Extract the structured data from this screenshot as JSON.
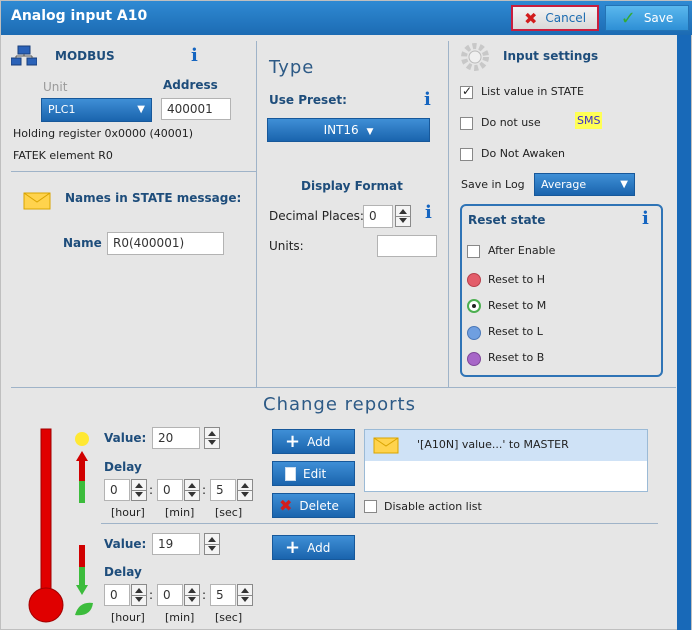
{
  "window": {
    "title": "Analog input A10",
    "cancel_label": "Cancel",
    "save_label": "Save"
  },
  "modbus": {
    "title": "MODBUS",
    "unit_label": "Unit",
    "address_label": "Address",
    "unit_value": "PLC1",
    "address_value": "400001",
    "register_text": "Holding register 0x0000 (40001)",
    "element_text": "FATEK element R0"
  },
  "names": {
    "title": "Names in STATE message:",
    "name_label": "Name",
    "name_value": "R0(400001)"
  },
  "type": {
    "title": "Type",
    "use_preset_label": "Use Preset:",
    "preset_value": "INT16",
    "display_format_label": "Display Format",
    "decimal_places_label": "Decimal Places:",
    "decimal_places_value": "0",
    "units_label": "Units:",
    "units_value": ""
  },
  "input_settings": {
    "title": "Input settings",
    "list_value_label": "List value in STATE",
    "list_value_checked": true,
    "do_not_use_label": "Do not use",
    "do_not_use_checked": false,
    "sms_badge": "SMS",
    "do_not_awaken_label": "Do Not Awaken",
    "do_not_awaken_checked": false,
    "save_in_log_label": "Save in Log",
    "save_in_log_value": "Average"
  },
  "reset_state": {
    "title": "Reset state",
    "after_enable_label": "After Enable",
    "after_enable_checked": false,
    "options": [
      {
        "label": "Reset to H",
        "color": "#e35d6a",
        "selected": false
      },
      {
        "label": "Reset to M",
        "color": "#4caf50",
        "selected": true
      },
      {
        "label": "Reset to L",
        "color": "#6f9fe0",
        "selected": false
      },
      {
        "label": "Reset to B",
        "color": "#a766c8",
        "selected": false
      }
    ]
  },
  "change_reports": {
    "title": "Change reports",
    "upper": {
      "value_label": "Value:",
      "value": "20",
      "delay_label": "Delay",
      "hour": "0",
      "min": "0",
      "sec": "5",
      "hour_label": "[hour]",
      "min_label": "[min]",
      "sec_label": "[sec]",
      "add_label": "Add",
      "edit_label": "Edit",
      "delete_label": "Delete",
      "action_item": "'[A10N] value...' to MASTER",
      "disable_label": "Disable action list"
    },
    "lower": {
      "value_label": "Value:",
      "value": "19",
      "delay_label": "Delay",
      "hour": "0",
      "min": "0",
      "sec": "5",
      "hour_label": "[hour]",
      "min_label": "[min]",
      "sec_label": "[sec]",
      "add_label": "Add"
    }
  },
  "colors": {
    "accent": "#1a64ad",
    "cancel_border": "#c81e3e",
    "thermo": "#e00000"
  }
}
